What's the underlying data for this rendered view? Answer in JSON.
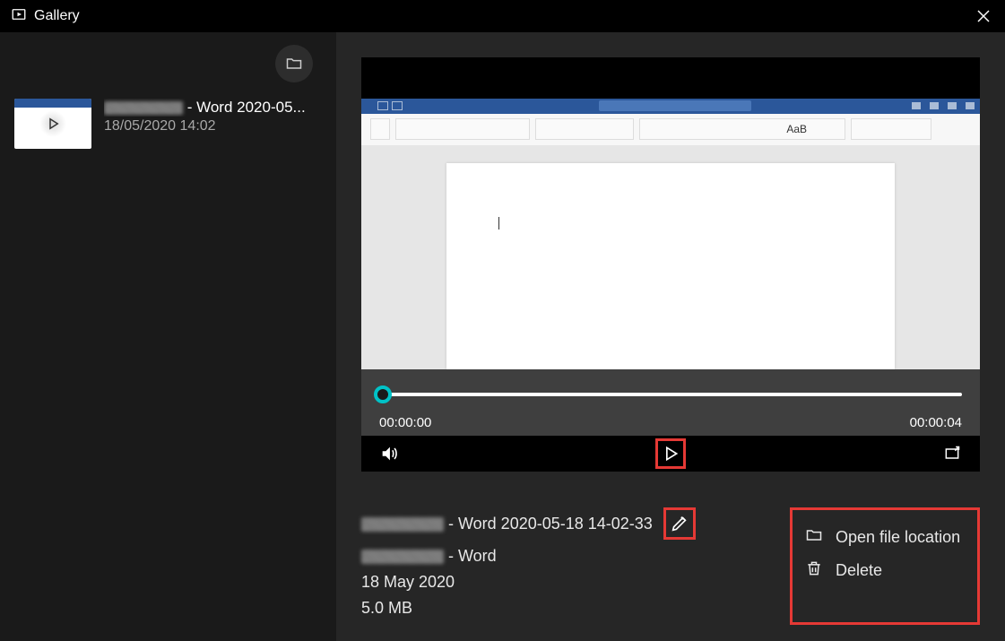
{
  "header": {
    "title": "Gallery"
  },
  "sidebar": {
    "item": {
      "title_suffix": " - Word 2020-05...",
      "date": "18/05/2020 14:02"
    }
  },
  "player": {
    "time_current": "00:00:00",
    "time_total": "00:00:04"
  },
  "details": {
    "filename_suffix": " - Word 2020-05-18 14-02-33",
    "app_suffix": " - Word",
    "date": "18 May 2020",
    "size": "5.0 MB"
  },
  "actions": {
    "open_location": "Open file location",
    "delete": "Delete"
  }
}
